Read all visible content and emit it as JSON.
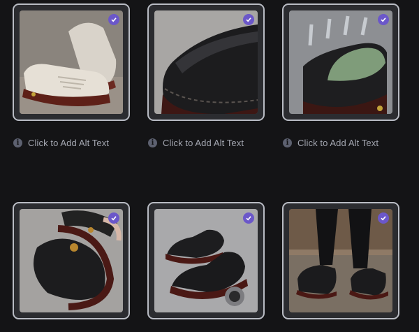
{
  "gallery": {
    "items": [
      {
        "name": "white-shoe-pair",
        "alt_label": "Click to Add Alt Text",
        "selected": true,
        "icon": "check-icon"
      },
      {
        "name": "black-shoe-closeup",
        "alt_label": "Click to Add Alt Text",
        "selected": true,
        "icon": "check-icon"
      },
      {
        "name": "breathable-insole",
        "alt_label": "Click to Add Alt Text",
        "selected": true,
        "icon": "check-icon"
      },
      {
        "name": "flexible-sole",
        "alt_label": "",
        "selected": true,
        "icon": "check-icon"
      },
      {
        "name": "black-shoe-pair",
        "alt_label": "",
        "selected": true,
        "icon": "check-icon"
      },
      {
        "name": "shoes-worn",
        "alt_label": "",
        "selected": true,
        "icon": "check-icon"
      }
    ]
  },
  "colors": {
    "background": "#141416",
    "card_border": "#b9bcc4",
    "check_badge": "#6b57c9",
    "label_text": "#a3a6b0",
    "info_icon": "#5d6170"
  },
  "icons": {
    "selected": "check-icon",
    "alt_text": "info-icon"
  }
}
